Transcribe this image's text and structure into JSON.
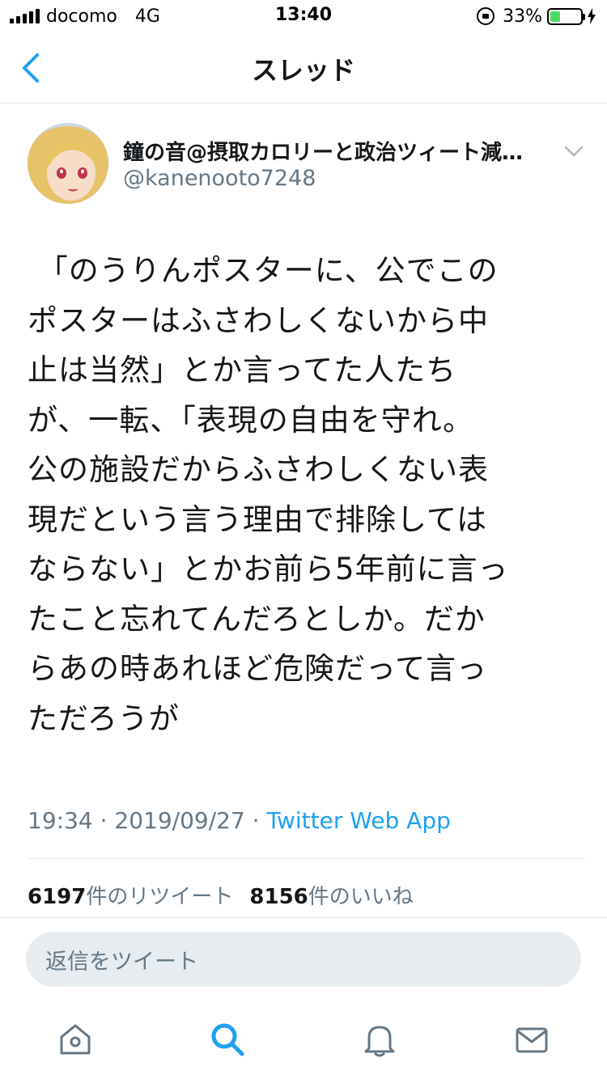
{
  "status_bar": {
    "carrier": "docomo",
    "network": "4G",
    "time": "13:40",
    "battery_percent": "33%",
    "battery_level": 0.33,
    "battery_color": "#4cd964"
  },
  "nav": {
    "title": "スレッド",
    "back_icon": "chevron-left-icon",
    "accent_color": "#1da1f2"
  },
  "tweet": {
    "display_name": "鐘の音@摂取カロリーと政治ツィート減…",
    "handle": "@kanenooto7248",
    "text": " 「のうりんポスターに、公でこの\nポスターはふさわしくないから中\n止は当然」とか言ってた人たち\nが、一転、「表現の自由を守れ。\n公の施設だからふさわしくない表\n現だという言う理由で排除しては\nならない」とかお前ら5年前に言っ\nたこと忘れてんだろとしか。だか\nらあの時あれほど危険だって言っ\nただろうが",
    "timestamp": "19:34 · 2019/09/27 · ",
    "source": "Twitter Web App",
    "retweet_count": "6197",
    "retweet_label": "件のリツイート",
    "like_count": "8156",
    "like_label": "件のいいね"
  },
  "reply": {
    "placeholder": "返信をツイート"
  },
  "tabbar": {
    "items": [
      {
        "icon": "home-icon",
        "active": false
      },
      {
        "icon": "search-icon",
        "active": true
      },
      {
        "icon": "bell-icon",
        "active": false
      },
      {
        "icon": "mail-icon",
        "active": false
      }
    ]
  }
}
